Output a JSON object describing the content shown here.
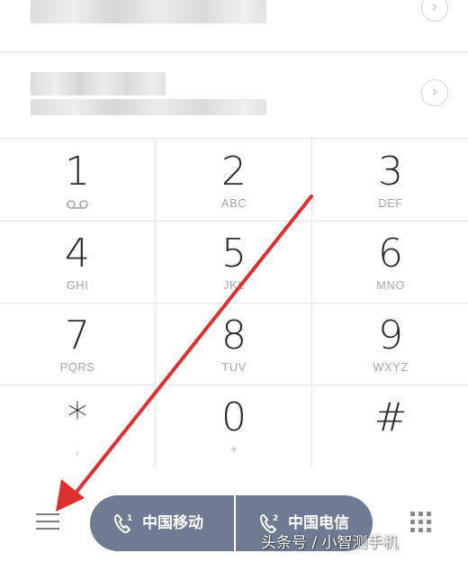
{
  "recent_calls": [
    {
      "name": "",
      "detail": "",
      "icon": "chevron-right-icon"
    },
    {
      "name": "",
      "detail": "",
      "icon": "chevron-right-icon"
    }
  ],
  "keypad": [
    {
      "digit": "1",
      "letters": "ꝏ"
    },
    {
      "digit": "2",
      "letters": "ABC"
    },
    {
      "digit": "3",
      "letters": "DEF"
    },
    {
      "digit": "4",
      "letters": "GHI"
    },
    {
      "digit": "5",
      "letters": "JKL"
    },
    {
      "digit": "6",
      "letters": "MNO"
    },
    {
      "digit": "7",
      "letters": "PQRS"
    },
    {
      "digit": "8",
      "letters": "TUV"
    },
    {
      "digit": "9",
      "letters": "WXYZ"
    },
    {
      "digit": "*",
      "letters": ","
    },
    {
      "digit": "0",
      "letters": "+"
    },
    {
      "digit": "#",
      "letters": ""
    }
  ],
  "bottom_bar": {
    "menu_icon": "hamburger-menu-icon",
    "sim1_label": "中国移动",
    "sim2_label": "中国电信",
    "dialpad_icon": "dialpad-grid-icon",
    "sim_button_color": "#6f7b92"
  },
  "watermark": "头条号 / 小智测手机",
  "annotation_color": "#e02f2f"
}
